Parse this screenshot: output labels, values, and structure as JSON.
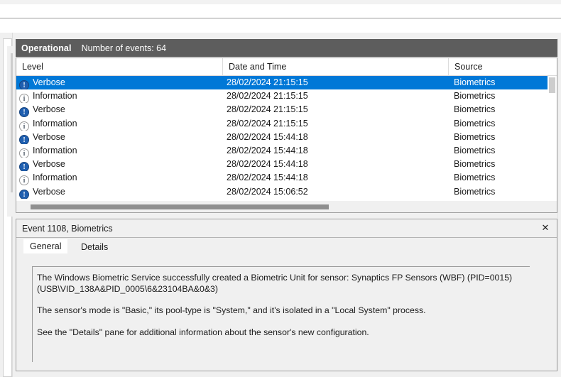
{
  "window": {
    "log_name": "Operational",
    "event_count_label": "Number of events: 64"
  },
  "event_list": {
    "columns": [
      "Level",
      "Date and Time",
      "Source"
    ],
    "rows": [
      {
        "level": "Verbose",
        "icon": "verbose-icon",
        "date": "28/02/2024 21:15:15",
        "source": "Biometrics",
        "selected": true
      },
      {
        "level": "Information",
        "icon": "information-icon",
        "date": "28/02/2024 21:15:15",
        "source": "Biometrics",
        "selected": false
      },
      {
        "level": "Verbose",
        "icon": "verbose-icon",
        "date": "28/02/2024 21:15:15",
        "source": "Biometrics",
        "selected": false
      },
      {
        "level": "Information",
        "icon": "information-icon",
        "date": "28/02/2024 21:15:15",
        "source": "Biometrics",
        "selected": false
      },
      {
        "level": "Verbose",
        "icon": "verbose-icon",
        "date": "28/02/2024 15:44:18",
        "source": "Biometrics",
        "selected": false
      },
      {
        "level": "Information",
        "icon": "information-icon",
        "date": "28/02/2024 15:44:18",
        "source": "Biometrics",
        "selected": false
      },
      {
        "level": "Verbose",
        "icon": "verbose-icon",
        "date": "28/02/2024 15:44:18",
        "source": "Biometrics",
        "selected": false
      },
      {
        "level": "Information",
        "icon": "information-icon",
        "date": "28/02/2024 15:44:18",
        "source": "Biometrics",
        "selected": false
      },
      {
        "level": "Verbose",
        "icon": "verbose-icon",
        "date": "28/02/2024 15:06:52",
        "source": "Biometrics",
        "selected": false
      }
    ],
    "icon_glyphs": {
      "verbose": "!",
      "information": "i"
    }
  },
  "details": {
    "title": "Event 1108, Biometrics",
    "close_label": "✕",
    "tabs": [
      {
        "label": "General",
        "active": true
      },
      {
        "label": "Details",
        "active": false
      }
    ],
    "body_paragraphs": [
      "The Windows Biometric Service successfully created a Biometric Unit for sensor: Synaptics FP Sensors (WBF) (PID=0015) (USB\\VID_138A&PID_0005\\6&23104BA&0&3)",
      "The sensor's mode is \"Basic,\" its pool-type is \"System,\" and it's isolated in a \"Local System\" process.",
      "See the \"Details\" pane for additional information about the sensor's new configuration."
    ]
  },
  "colors": {
    "selection_blue": "#0078d7",
    "header_bar_gray": "#5d5d5d",
    "verbose_icon_blue": "#1f5fb0",
    "panel_gray": "#f0f0f0"
  }
}
